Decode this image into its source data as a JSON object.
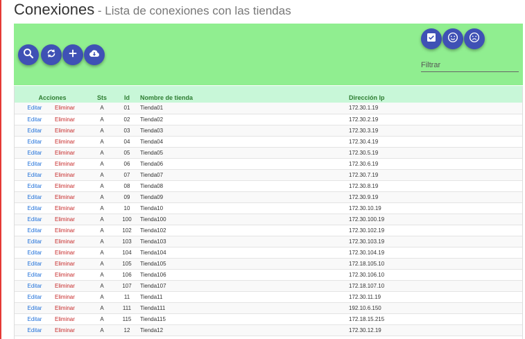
{
  "header": {
    "title": "Conexiones",
    "separator": " - ",
    "subtitle": "Lista de conexiones con las tiendas"
  },
  "toolbar": {
    "filter_placeholder": "Filtrar",
    "buttons": [
      "search-icon",
      "refresh-icon",
      "add-icon",
      "cloud-download-icon",
      "check-box-icon",
      "smile-face-icon",
      "sad-face-icon"
    ]
  },
  "colors": {
    "toolbar_bg": "#90ee90",
    "fab": "#3f51b5",
    "table_header_bg": "#c8f7d8",
    "edit_link": "#1e6fd9",
    "delete_link": "#c62828"
  },
  "table": {
    "headers": {
      "acciones": "Acciones",
      "sts": "Sts",
      "id": "Id",
      "nombre": "Nombre de tienda",
      "ip": "Dirección Ip"
    },
    "edit_label": "Editar",
    "delete_label": "Eliminar",
    "rows": [
      {
        "sts": "A",
        "id": "01",
        "nombre": "Tienda01",
        "ip": "172.30.1.19"
      },
      {
        "sts": "A",
        "id": "02",
        "nombre": "Tienda02",
        "ip": "172.30.2.19"
      },
      {
        "sts": "A",
        "id": "03",
        "nombre": "Tienda03",
        "ip": "172.30.3.19"
      },
      {
        "sts": "A",
        "id": "04",
        "nombre": "Tienda04",
        "ip": "172.30.4.19"
      },
      {
        "sts": "A",
        "id": "05",
        "nombre": "Tienda05",
        "ip": "172.30.5.19"
      },
      {
        "sts": "A",
        "id": "06",
        "nombre": "Tienda06",
        "ip": "172.30.6.19"
      },
      {
        "sts": "A",
        "id": "07",
        "nombre": "Tienda07",
        "ip": "172.30.7.19"
      },
      {
        "sts": "A",
        "id": "08",
        "nombre": "Tienda08",
        "ip": "172.30.8.19"
      },
      {
        "sts": "A",
        "id": "09",
        "nombre": "Tienda09",
        "ip": "172.30.9.19"
      },
      {
        "sts": "A",
        "id": "10",
        "nombre": "Tienda10",
        "ip": "172.30.10.19"
      },
      {
        "sts": "A",
        "id": "100",
        "nombre": "Tienda100",
        "ip": "172.30.100.19"
      },
      {
        "sts": "A",
        "id": "102",
        "nombre": "Tienda102",
        "ip": "172.30.102.19"
      },
      {
        "sts": "A",
        "id": "103",
        "nombre": "Tienda103",
        "ip": "172.30.103.19"
      },
      {
        "sts": "A",
        "id": "104",
        "nombre": "Tienda104",
        "ip": "172.30.104.19"
      },
      {
        "sts": "A",
        "id": "105",
        "nombre": "Tienda105",
        "ip": "172.18.105.10"
      },
      {
        "sts": "A",
        "id": "106",
        "nombre": "Tienda106",
        "ip": "172.30.106.10"
      },
      {
        "sts": "A",
        "id": "107",
        "nombre": "Tienda107",
        "ip": "172.18.107.10"
      },
      {
        "sts": "A",
        "id": "11",
        "nombre": "Tienda11",
        "ip": "172.30.11.19"
      },
      {
        "sts": "A",
        "id": "111",
        "nombre": "Tienda111",
        "ip": "192.10.6.150"
      },
      {
        "sts": "A",
        "id": "115",
        "nombre": "Tienda115",
        "ip": "172.18.15.215"
      },
      {
        "sts": "A",
        "id": "12",
        "nombre": "Tienda12",
        "ip": "172.30.12.19"
      }
    ]
  }
}
